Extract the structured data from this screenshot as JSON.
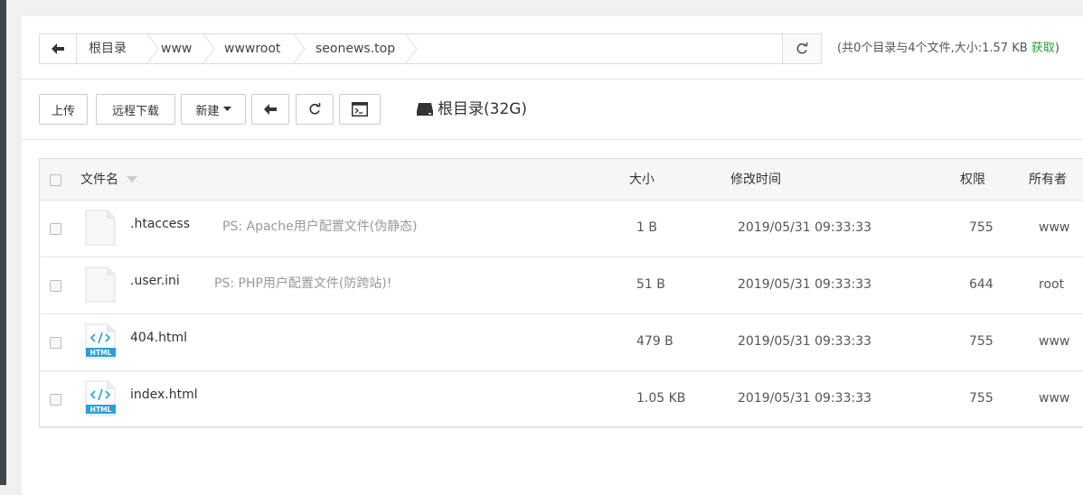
{
  "breadcrumb": {
    "items": [
      "根目录",
      "www",
      "wwwroot",
      "seonews.top"
    ],
    "summary": "(共0个目录与4个文件,大小:1.57 KB",
    "fetch_link": "获取",
    "close_paren": ")"
  },
  "toolbar": {
    "upload": "上传",
    "remote_download": "远程下载",
    "new": "新建",
    "disk_label": "根目录(32G)"
  },
  "table": {
    "headers": {
      "name": "文件名",
      "size": "大小",
      "mtime": "修改时间",
      "perm": "权限",
      "owner": "所有者"
    },
    "rows": [
      {
        "name": ".htaccess",
        "note": "PS: Apache用户配置文件(伪静态)",
        "size": "1 B",
        "mtime": "2019/05/31 09:33:33",
        "perm": "755",
        "owner": "www",
        "icon": "file-icon"
      },
      {
        "name": ".user.ini",
        "note": "PS: PHP用户配置文件(防跨站)!",
        "size": "51 B",
        "mtime": "2019/05/31 09:33:33",
        "perm": "644",
        "owner": "root",
        "icon": "file-icon"
      },
      {
        "name": "404.html",
        "note": "",
        "size": "479 B",
        "mtime": "2019/05/31 09:33:33",
        "perm": "755",
        "owner": "www",
        "icon": "html-file-icon"
      },
      {
        "name": "index.html",
        "note": "",
        "size": "1.05 KB",
        "mtime": "2019/05/31 09:33:33",
        "perm": "755",
        "owner": "www",
        "icon": "html-file-icon"
      }
    ]
  },
  "colors": {
    "link_green": "#20a53a",
    "html_icon_blue": "#2a9fd8"
  }
}
